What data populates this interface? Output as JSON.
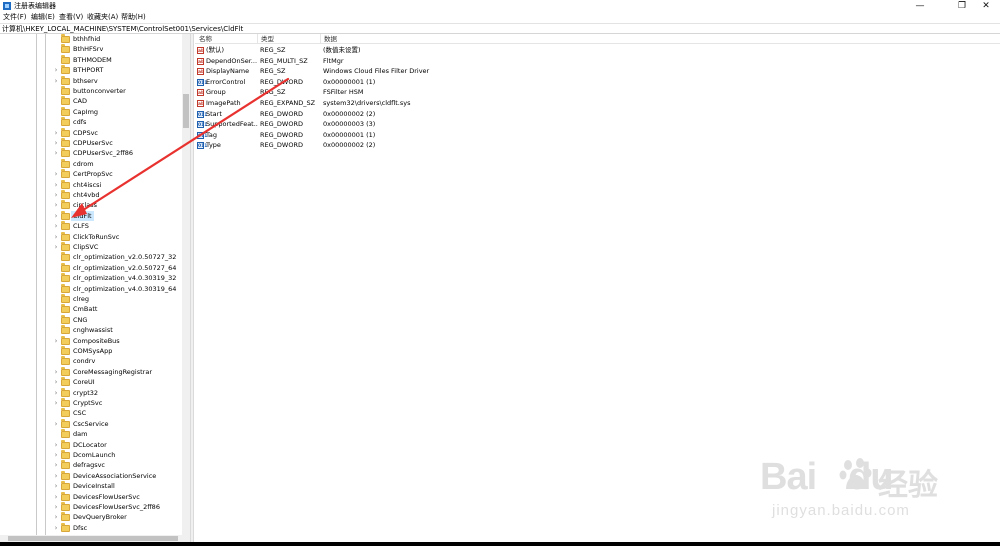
{
  "window": {
    "title": "注册表编辑器",
    "controls": {
      "minimize": "—",
      "maximize": "❐",
      "close": "✕"
    }
  },
  "menu": [
    "文件(F)",
    "编辑(E)",
    "查看(V)",
    "收藏夹(A)",
    "帮助(H)"
  ],
  "address": "计算机\\HKEY_LOCAL_MACHINE\\SYSTEM\\ControlSet001\\Services\\CldFlt",
  "tree": {
    "items": [
      {
        "label": "bthhfhid",
        "expandable": false
      },
      {
        "label": "BthHFSrv",
        "expandable": false
      },
      {
        "label": "BTHMODEM",
        "expandable": false
      },
      {
        "label": "BTHPORT",
        "expandable": true
      },
      {
        "label": "bthserv",
        "expandable": true
      },
      {
        "label": "buttonconverter",
        "expandable": false
      },
      {
        "label": "CAD",
        "expandable": false
      },
      {
        "label": "CapImg",
        "expandable": false
      },
      {
        "label": "cdfs",
        "expandable": false
      },
      {
        "label": "CDPSvc",
        "expandable": true
      },
      {
        "label": "CDPUserSvc",
        "expandable": true
      },
      {
        "label": "CDPUserSvc_2ff86",
        "expandable": true
      },
      {
        "label": "cdrom",
        "expandable": false
      },
      {
        "label": "CertPropSvc",
        "expandable": true
      },
      {
        "label": "cht4iscsi",
        "expandable": true
      },
      {
        "label": "cht4vbd",
        "expandable": true
      },
      {
        "label": "circlass",
        "expandable": true
      },
      {
        "label": "CldFlt",
        "expandable": true,
        "selected": true
      },
      {
        "label": "CLFS",
        "expandable": true
      },
      {
        "label": "ClickToRunSvc",
        "expandable": true
      },
      {
        "label": "ClipSVC",
        "expandable": true
      },
      {
        "label": "clr_optimization_v2.0.50727_32",
        "expandable": false
      },
      {
        "label": "clr_optimization_v2.0.50727_64",
        "expandable": false
      },
      {
        "label": "clr_optimization_v4.0.30319_32",
        "expandable": false
      },
      {
        "label": "clr_optimization_v4.0.30319_64",
        "expandable": false
      },
      {
        "label": "clreg",
        "expandable": false
      },
      {
        "label": "CmBatt",
        "expandable": false
      },
      {
        "label": "CNG",
        "expandable": false
      },
      {
        "label": "cnghwassist",
        "expandable": false
      },
      {
        "label": "CompositeBus",
        "expandable": true
      },
      {
        "label": "COMSysApp",
        "expandable": false
      },
      {
        "label": "condrv",
        "expandable": false
      },
      {
        "label": "CoreMessagingRegistrar",
        "expandable": true
      },
      {
        "label": "CoreUI",
        "expandable": true
      },
      {
        "label": "crypt32",
        "expandable": true
      },
      {
        "label": "CryptSvc",
        "expandable": true
      },
      {
        "label": "CSC",
        "expandable": false
      },
      {
        "label": "CscService",
        "expandable": true
      },
      {
        "label": "dam",
        "expandable": false
      },
      {
        "label": "DCLocator",
        "expandable": true
      },
      {
        "label": "DcomLaunch",
        "expandable": true
      },
      {
        "label": "defragsvc",
        "expandable": true
      },
      {
        "label": "DeviceAssociationService",
        "expandable": true
      },
      {
        "label": "DeviceInstall",
        "expandable": true
      },
      {
        "label": "DevicesFlowUserSvc",
        "expandable": true
      },
      {
        "label": "DevicesFlowUserSvc_2ff86",
        "expandable": true
      },
      {
        "label": "DevQueryBroker",
        "expandable": true
      },
      {
        "label": "Dfsc",
        "expandable": true
      }
    ]
  },
  "values": {
    "headers": {
      "name": "名称",
      "type": "类型",
      "data": "数据"
    },
    "rows": [
      {
        "icon": "sz",
        "name": "(默认)",
        "type": "REG_SZ",
        "data": "(数值未设置)"
      },
      {
        "icon": "sz",
        "name": "DependOnSer...",
        "type": "REG_MULTI_SZ",
        "data": "FltMgr"
      },
      {
        "icon": "sz",
        "name": "DisplayName",
        "type": "REG_SZ",
        "data": "Windows Cloud Files Filter Driver"
      },
      {
        "icon": "bin",
        "name": "ErrorControl",
        "type": "REG_DWORD",
        "data": "0x00000001 (1)"
      },
      {
        "icon": "sz",
        "name": "Group",
        "type": "REG_SZ",
        "data": "FSFilter HSM"
      },
      {
        "icon": "sz",
        "name": "ImagePath",
        "type": "REG_EXPAND_SZ",
        "data": "system32\\drivers\\cldflt.sys"
      },
      {
        "icon": "bin",
        "name": "Start",
        "type": "REG_DWORD",
        "data": "0x00000002 (2)"
      },
      {
        "icon": "bin",
        "name": "SupportedFeat...",
        "type": "REG_DWORD",
        "data": "0x00000003 (3)"
      },
      {
        "icon": "bin",
        "name": "Tag",
        "type": "REG_DWORD",
        "data": "0x00000001 (1)"
      },
      {
        "icon": "bin",
        "name": "Type",
        "type": "REG_DWORD",
        "data": "0x00000002 (2)"
      }
    ]
  },
  "icons": {
    "string_value": "ab",
    "binary_value": "011"
  },
  "annotation": {
    "color": "#e8322f"
  },
  "watermark": {
    "logo": "Bai",
    "logo_tail": "du",
    "cn": "经验",
    "url": "jingyan.baidu.com"
  }
}
